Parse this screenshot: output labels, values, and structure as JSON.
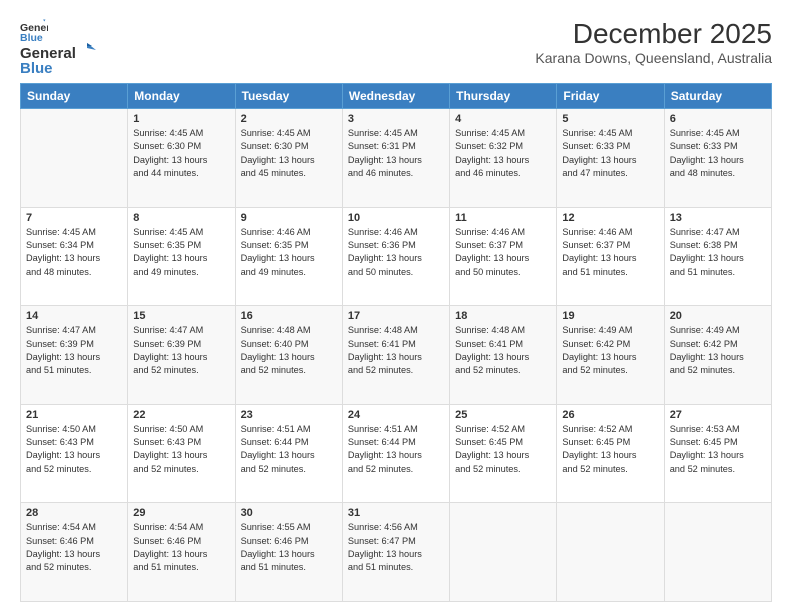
{
  "logo": {
    "general": "General",
    "blue": "Blue"
  },
  "title": "December 2025",
  "location": "Karana Downs, Queensland, Australia",
  "days_of_week": [
    "Sunday",
    "Monday",
    "Tuesday",
    "Wednesday",
    "Thursday",
    "Friday",
    "Saturday"
  ],
  "weeks": [
    [
      {
        "day": "",
        "info": ""
      },
      {
        "day": "1",
        "info": "Sunrise: 4:45 AM\nSunset: 6:30 PM\nDaylight: 13 hours\nand 44 minutes."
      },
      {
        "day": "2",
        "info": "Sunrise: 4:45 AM\nSunset: 6:30 PM\nDaylight: 13 hours\nand 45 minutes."
      },
      {
        "day": "3",
        "info": "Sunrise: 4:45 AM\nSunset: 6:31 PM\nDaylight: 13 hours\nand 46 minutes."
      },
      {
        "day": "4",
        "info": "Sunrise: 4:45 AM\nSunset: 6:32 PM\nDaylight: 13 hours\nand 46 minutes."
      },
      {
        "day": "5",
        "info": "Sunrise: 4:45 AM\nSunset: 6:33 PM\nDaylight: 13 hours\nand 47 minutes."
      },
      {
        "day": "6",
        "info": "Sunrise: 4:45 AM\nSunset: 6:33 PM\nDaylight: 13 hours\nand 48 minutes."
      }
    ],
    [
      {
        "day": "7",
        "info": "Sunrise: 4:45 AM\nSunset: 6:34 PM\nDaylight: 13 hours\nand 48 minutes."
      },
      {
        "day": "8",
        "info": "Sunrise: 4:45 AM\nSunset: 6:35 PM\nDaylight: 13 hours\nand 49 minutes."
      },
      {
        "day": "9",
        "info": "Sunrise: 4:46 AM\nSunset: 6:35 PM\nDaylight: 13 hours\nand 49 minutes."
      },
      {
        "day": "10",
        "info": "Sunrise: 4:46 AM\nSunset: 6:36 PM\nDaylight: 13 hours\nand 50 minutes."
      },
      {
        "day": "11",
        "info": "Sunrise: 4:46 AM\nSunset: 6:37 PM\nDaylight: 13 hours\nand 50 minutes."
      },
      {
        "day": "12",
        "info": "Sunrise: 4:46 AM\nSunset: 6:37 PM\nDaylight: 13 hours\nand 51 minutes."
      },
      {
        "day": "13",
        "info": "Sunrise: 4:47 AM\nSunset: 6:38 PM\nDaylight: 13 hours\nand 51 minutes."
      }
    ],
    [
      {
        "day": "14",
        "info": "Sunrise: 4:47 AM\nSunset: 6:39 PM\nDaylight: 13 hours\nand 51 minutes."
      },
      {
        "day": "15",
        "info": "Sunrise: 4:47 AM\nSunset: 6:39 PM\nDaylight: 13 hours\nand 52 minutes."
      },
      {
        "day": "16",
        "info": "Sunrise: 4:48 AM\nSunset: 6:40 PM\nDaylight: 13 hours\nand 52 minutes."
      },
      {
        "day": "17",
        "info": "Sunrise: 4:48 AM\nSunset: 6:41 PM\nDaylight: 13 hours\nand 52 minutes."
      },
      {
        "day": "18",
        "info": "Sunrise: 4:48 AM\nSunset: 6:41 PM\nDaylight: 13 hours\nand 52 minutes."
      },
      {
        "day": "19",
        "info": "Sunrise: 4:49 AM\nSunset: 6:42 PM\nDaylight: 13 hours\nand 52 minutes."
      },
      {
        "day": "20",
        "info": "Sunrise: 4:49 AM\nSunset: 6:42 PM\nDaylight: 13 hours\nand 52 minutes."
      }
    ],
    [
      {
        "day": "21",
        "info": "Sunrise: 4:50 AM\nSunset: 6:43 PM\nDaylight: 13 hours\nand 52 minutes."
      },
      {
        "day": "22",
        "info": "Sunrise: 4:50 AM\nSunset: 6:43 PM\nDaylight: 13 hours\nand 52 minutes."
      },
      {
        "day": "23",
        "info": "Sunrise: 4:51 AM\nSunset: 6:44 PM\nDaylight: 13 hours\nand 52 minutes."
      },
      {
        "day": "24",
        "info": "Sunrise: 4:51 AM\nSunset: 6:44 PM\nDaylight: 13 hours\nand 52 minutes."
      },
      {
        "day": "25",
        "info": "Sunrise: 4:52 AM\nSunset: 6:45 PM\nDaylight: 13 hours\nand 52 minutes."
      },
      {
        "day": "26",
        "info": "Sunrise: 4:52 AM\nSunset: 6:45 PM\nDaylight: 13 hours\nand 52 minutes."
      },
      {
        "day": "27",
        "info": "Sunrise: 4:53 AM\nSunset: 6:45 PM\nDaylight: 13 hours\nand 52 minutes."
      }
    ],
    [
      {
        "day": "28",
        "info": "Sunrise: 4:54 AM\nSunset: 6:46 PM\nDaylight: 13 hours\nand 52 minutes."
      },
      {
        "day": "29",
        "info": "Sunrise: 4:54 AM\nSunset: 6:46 PM\nDaylight: 13 hours\nand 51 minutes."
      },
      {
        "day": "30",
        "info": "Sunrise: 4:55 AM\nSunset: 6:46 PM\nDaylight: 13 hours\nand 51 minutes."
      },
      {
        "day": "31",
        "info": "Sunrise: 4:56 AM\nSunset: 6:47 PM\nDaylight: 13 hours\nand 51 minutes."
      },
      {
        "day": "",
        "info": ""
      },
      {
        "day": "",
        "info": ""
      },
      {
        "day": "",
        "info": ""
      }
    ]
  ]
}
